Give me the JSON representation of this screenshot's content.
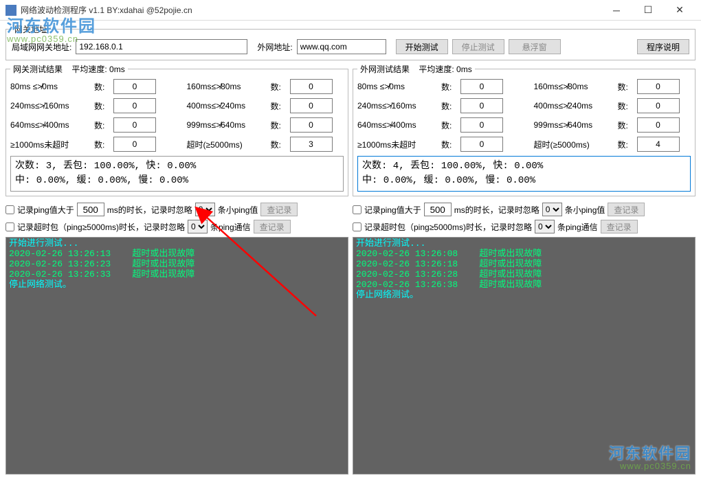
{
  "window": {
    "title": "网络波动检测程序 v1.1 BY:xdahai @52pojie.cn"
  },
  "watermark": {
    "t1": "河东软件园",
    "t2": "www.pc0359.cn"
  },
  "addr": {
    "legend": "网关地址",
    "lan_label": "局域网网关地址:",
    "lan_value": "192.168.0.1",
    "wan_label": "外网地址:",
    "wan_value": "www.qq.com",
    "start": "开始测试",
    "stop": "停止测试",
    "float": "悬浮窗",
    "help": "程序说明"
  },
  "left": {
    "legend": "网关测试结果",
    "avg_label": "平均速度:",
    "avg_value": "0ms",
    "metrics": [
      {
        "l": "80ms ≤≯0ms",
        "n": "数:",
        "v": "0"
      },
      {
        "l": "160ms≤≯80ms",
        "n": "数:",
        "v": "0"
      },
      {
        "l": "240ms≤≯160ms",
        "n": "数:",
        "v": "0"
      },
      {
        "l": "400ms≤≯240ms",
        "n": "数:",
        "v": "0"
      },
      {
        "l": "640ms≤≯400ms",
        "n": "数:",
        "v": "0"
      },
      {
        "l": "999ms≤≯640ms",
        "n": "数:",
        "v": "0"
      },
      {
        "l": "≥1000ms未超时",
        "n": "数:",
        "v": "0"
      },
      {
        "l": "超时(≥5000ms)",
        "n": "数:",
        "v": "3"
      }
    ],
    "summary1": "次数: 3, 丢包: 100.00%, 快: 0.00%",
    "summary2": "中: 0.00%, 缓: 0.00%, 慢: 0.00%",
    "opt1_a": "记录ping值大于",
    "opt1_val": "500",
    "opt1_b": "ms的时长，记录时忽略",
    "opt1_sel": "0",
    "opt1_c": "条小ping值",
    "opt1_btn": "查记录",
    "opt2_a": "记录超时包（ping≥5000ms)时长，记录时忽略",
    "opt2_sel": "0",
    "opt2_b": "条ping通信",
    "opt2_btn": "查记录",
    "log": [
      {
        "t": "开始进行测试...",
        "c": "c0",
        "ts": ""
      },
      {
        "t": "超时或出现故障",
        "c": "c1",
        "ts": "2020-02-26 13:26:13"
      },
      {
        "t": "超时或出现故障",
        "c": "c1",
        "ts": "2020-02-26 13:26:23"
      },
      {
        "t": "超时或出现故障",
        "c": "c1",
        "ts": "2020-02-26 13:26:33"
      },
      {
        "t": "停止网络测试。",
        "c": "c0",
        "ts": ""
      }
    ]
  },
  "right": {
    "legend": "外网测试结果",
    "avg_label": "平均速度:",
    "avg_value": "0ms",
    "metrics": [
      {
        "l": "80ms ≤≯0ms",
        "n": "数:",
        "v": "0"
      },
      {
        "l": "160ms≤≯80ms",
        "n": "数:",
        "v": "0"
      },
      {
        "l": "240ms≤≯160ms",
        "n": "数:",
        "v": "0"
      },
      {
        "l": "400ms≤≯240ms",
        "n": "数:",
        "v": "0"
      },
      {
        "l": "640ms≤≯400ms",
        "n": "数:",
        "v": "0"
      },
      {
        "l": "999ms≤≯640ms",
        "n": "数:",
        "v": "0"
      },
      {
        "l": "≥1000ms未超时",
        "n": "数:",
        "v": "0"
      },
      {
        "l": "超时(≥5000ms)",
        "n": "数:",
        "v": "4"
      }
    ],
    "summary1": "次数: 4, 丢包: 100.00%, 快: 0.00%",
    "summary2": "中: 0.00%, 缓: 0.00%, 慢: 0.00%",
    "opt1_a": "记录ping值大于",
    "opt1_val": "500",
    "opt1_b": "ms的时长，记录时忽略",
    "opt1_sel": "0",
    "opt1_c": "条小ping值",
    "opt1_btn": "查记录",
    "opt2_a": "记录超时包（ping≥5000ms)时长，记录时忽略",
    "opt2_sel": "0",
    "opt2_b": "条ping通信",
    "opt2_btn": "查记录",
    "log": [
      {
        "t": "开始进行测试...",
        "c": "c0",
        "ts": ""
      },
      {
        "t": "超时或出现故障",
        "c": "c1",
        "ts": "2020-02-26 13:26:08"
      },
      {
        "t": "超时或出现故障",
        "c": "c1",
        "ts": "2020-02-26 13:26:18"
      },
      {
        "t": "超时或出现故障",
        "c": "c1",
        "ts": "2020-02-26 13:26:28"
      },
      {
        "t": "超时或出现故障",
        "c": "c1",
        "ts": "2020-02-26 13:26:38"
      },
      {
        "t": "停止网络测试。",
        "c": "c0",
        "ts": ""
      }
    ]
  }
}
